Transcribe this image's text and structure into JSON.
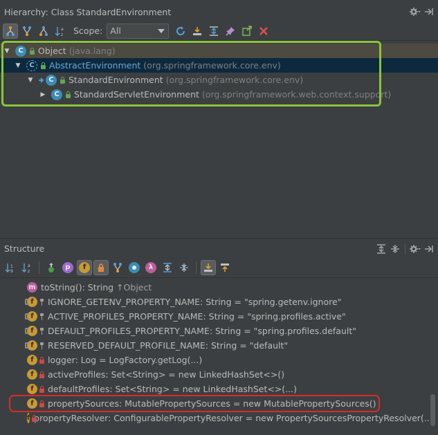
{
  "hierarchy": {
    "title": "Hierarchy: Class StandardEnvironment",
    "scope_label": "Scope:",
    "scope_value": "All",
    "rows": [
      {
        "name": "Object",
        "pkg": "(java.lang)",
        "icon_letter": "C"
      },
      {
        "name": "AbstractEnvironment",
        "pkg": "(org.springframework.core.env)",
        "icon_letter": "C"
      },
      {
        "name": "StandardEnvironment",
        "pkg": "(org.springframework.core.env)",
        "icon_letter": "C"
      },
      {
        "name": "StandardServletEnvironment",
        "pkg": "(org.springframework.web.context.support)",
        "icon_letter": "C"
      }
    ]
  },
  "structure": {
    "title": "Structure",
    "rows": [
      {
        "icon_letter": "m",
        "text": "toString(): String ",
        "suffix": "↑Object"
      },
      {
        "icon_letter": "f",
        "text": "IGNORE_GETENV_PROPERTY_NAME: String = \"spring.getenv.ignore\""
      },
      {
        "icon_letter": "f",
        "text": "ACTIVE_PROFILES_PROPERTY_NAME: String = \"spring.profiles.active\""
      },
      {
        "icon_letter": "f",
        "text": "DEFAULT_PROFILES_PROPERTY_NAME: String = \"spring.profiles.default\""
      },
      {
        "icon_letter": "f",
        "text": "RESERVED_DEFAULT_PROFILE_NAME: String = \"default\""
      },
      {
        "icon_letter": "f",
        "text": "logger: Log = LogFactory.getLog(...)"
      },
      {
        "icon_letter": "f",
        "text": "activeProfiles: Set<String> = new LinkedHashSet<>()"
      },
      {
        "icon_letter": "f",
        "text": "defaultProfiles: Set<String> = new LinkedHashSet<>(...)"
      },
      {
        "icon_letter": "f",
        "text": "propertySources: MutablePropertySources = new MutablePropertySources()"
      },
      {
        "icon_letter": "f",
        "text": "propertyResolver: ConfigurablePropertyResolver = new PropertySourcesPropertyResolver(...)"
      }
    ]
  },
  "colors": {
    "annotation_green": "#8ac43a",
    "annotation_red": "#d92b2b",
    "selection_blue": "#0d293e"
  }
}
